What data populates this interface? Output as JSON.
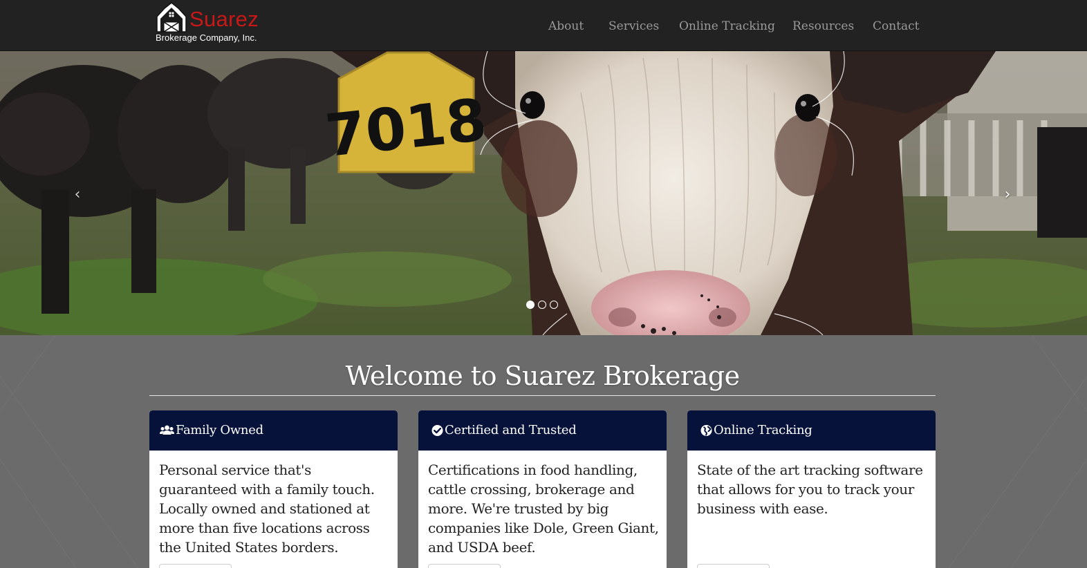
{
  "brand": {
    "name": "Suarez",
    "subtitle": "Brokerage Company, Inc.",
    "name_color": "#c81818"
  },
  "nav": {
    "items": [
      {
        "label": "About"
      },
      {
        "label": "Services"
      },
      {
        "label": "Online Tracking"
      },
      {
        "label": "Resources"
      },
      {
        "label": "Contact"
      }
    ]
  },
  "carousel": {
    "image": "calf-closeup-photo",
    "ear_tag_text": "7018",
    "slide_count": 3,
    "active_slide": 1,
    "prev_icon": "chevron-left-icon",
    "next_icon": "chevron-right-icon",
    "prev_glyph": "‹",
    "next_glyph": "›"
  },
  "main": {
    "heading": "Welcome to Suarez Brokerage",
    "panels": [
      {
        "icon": "users-icon",
        "title": "Family Owned",
        "body": "Personal service that's guaranteed with a family touch. Locally owned and stationed at more than five locations across the United States borders."
      },
      {
        "icon": "check-circle-icon",
        "title": "Certified and Trusted",
        "body": "Certifications in food handling, cattle crossing, brokerage and more. We're trusted by big companies like Dole, Green Giant, and USDA beef."
      },
      {
        "icon": "globe-icon",
        "title": "Online Tracking",
        "body": "State of the art tracking software that allows for you to track your business with ease."
      }
    ]
  },
  "colors": {
    "navbar_bg": "#222222",
    "nav_link": "#9a9a9a",
    "panel_header": "#06123a",
    "page_bg": "#6b6b6b"
  }
}
